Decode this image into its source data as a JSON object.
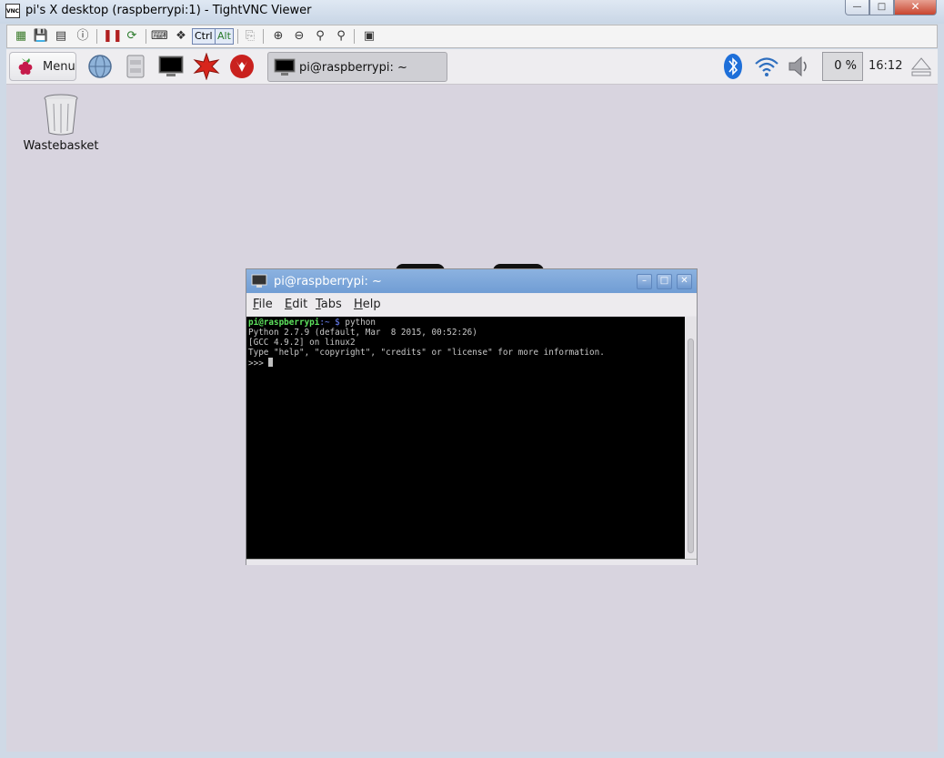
{
  "window": {
    "title": "pi's X desktop (raspberrypi:1) - TightVNC Viewer",
    "app_icon_text": "VNC"
  },
  "toolbar": {
    "ctrl_label": "Ctrl",
    "alt_label": "Alt"
  },
  "panel": {
    "menu_label": "Menu",
    "task_label": "pi@raspberrypi: ~",
    "cpu": "0 %",
    "clock": "16:12"
  },
  "desktop": {
    "trash_label": "Wastebasket"
  },
  "terminal": {
    "title": "pi@raspberrypi: ~",
    "menu": [
      "File",
      "Edit",
      "Tabs",
      "Help"
    ],
    "prompt_user": "pi@raspberrypi",
    "prompt_dir": ":~ $",
    "command": " python",
    "output": [
      "Python 2.7.9 (default, Mar  8 2015, 00:52:26)",
      "[GCC 4.9.2] on linux2",
      "Type \"help\", \"copyright\", \"credits\" or \"license\" for more information."
    ],
    "repl_prompt": ">>> "
  },
  "colors": {
    "accent": "#7aa2d8",
    "terminal_bg": "#000000",
    "prompt_green": "#5ee35e",
    "prompt_blue": "#6f87ff",
    "desktop_bg": "#d8d4df"
  }
}
